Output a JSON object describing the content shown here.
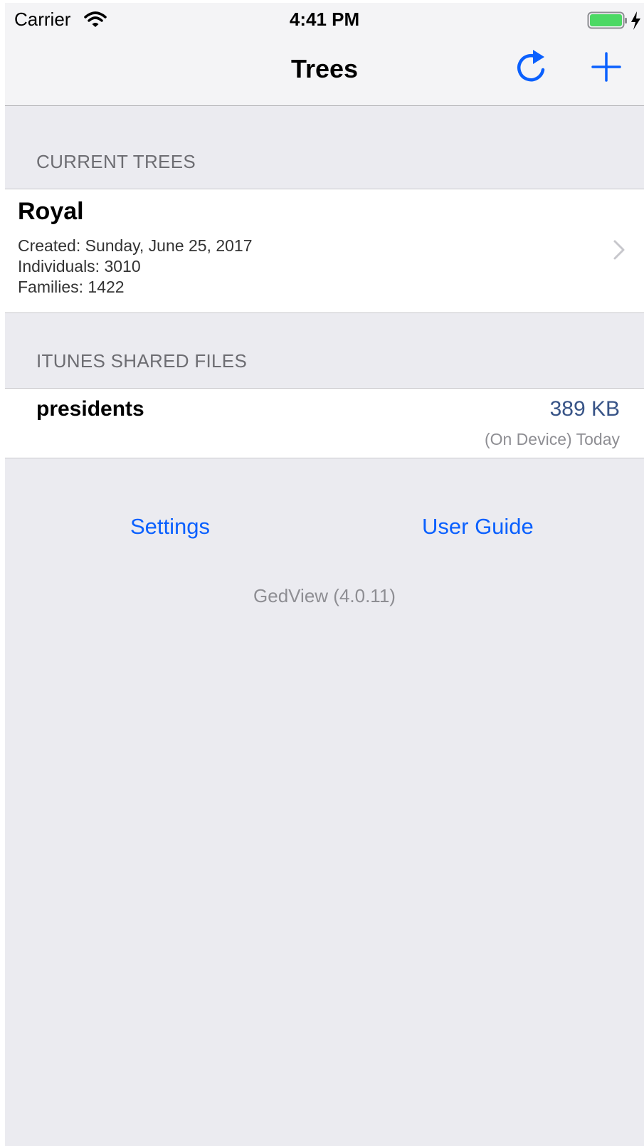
{
  "status_bar": {
    "carrier": "Carrier",
    "time": "4:41 PM",
    "icons": [
      "wifi-icon",
      "battery-icon",
      "charging-bolt-icon"
    ]
  },
  "nav": {
    "title": "Trees",
    "icons": [
      "refresh-icon",
      "plus-icon"
    ]
  },
  "current_trees": {
    "header": "CURRENT TREES",
    "items": [
      {
        "name": "Royal",
        "created": "Created: Sunday, June 25, 2017",
        "individuals": "Individuals: 3010",
        "families": "Families: 1422"
      }
    ]
  },
  "shared_files": {
    "header": "ITUNES SHARED FILES",
    "items": [
      {
        "name": "presidents",
        "size": "389 KB",
        "status": "(On Device) Today"
      }
    ]
  },
  "footer": {
    "settings_label": "Settings",
    "user_guide_label": "User Guide",
    "version": "GedView (4.0.11)"
  },
  "colors": {
    "accent": "#0a60fe",
    "background": "#ebebf0",
    "battery": "#4cd964",
    "file_size": "#385487"
  }
}
